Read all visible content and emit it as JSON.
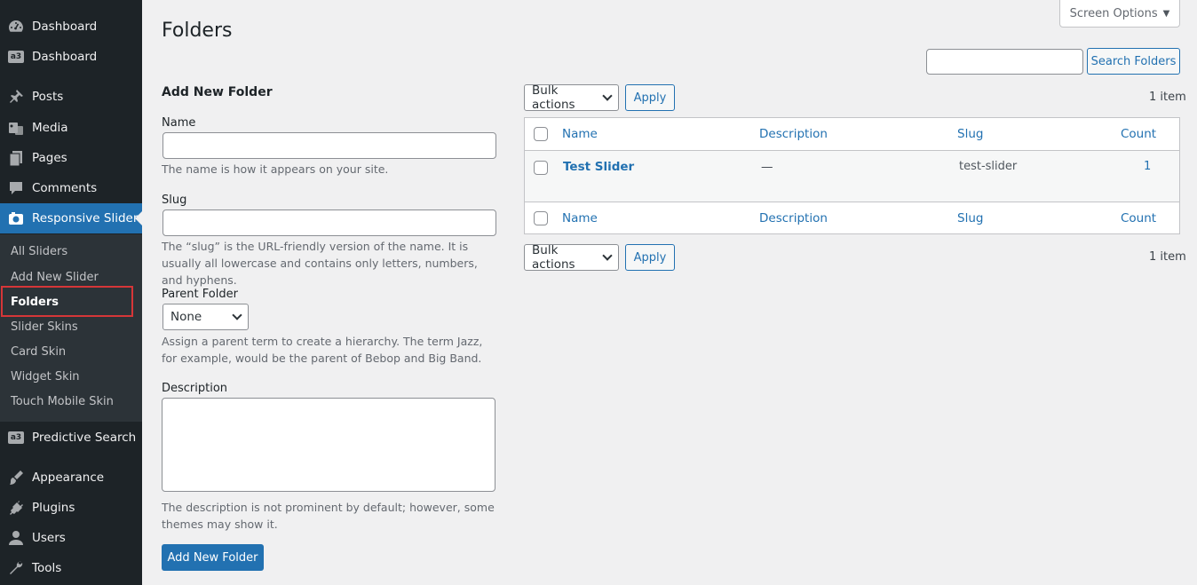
{
  "sidebar": {
    "items": [
      {
        "label": "Dashboard",
        "icon": "dashboard-icon"
      },
      {
        "label": "Dashboard",
        "icon": "a3-icon"
      },
      {
        "label": "Posts",
        "icon": "pin-icon"
      },
      {
        "label": "Media",
        "icon": "media-icon"
      },
      {
        "label": "Pages",
        "icon": "pages-icon"
      },
      {
        "label": "Comments",
        "icon": "comment-icon"
      },
      {
        "label": "Responsive Slider",
        "icon": "camera-icon"
      },
      {
        "label": "Predictive Search",
        "icon": "a3-icon"
      },
      {
        "label": "Appearance",
        "icon": "brush-icon"
      },
      {
        "label": "Plugins",
        "icon": "plug-icon"
      },
      {
        "label": "Users",
        "icon": "user-icon"
      },
      {
        "label": "Tools",
        "icon": "wrench-icon"
      }
    ],
    "submenu": [
      "All Sliders",
      "Add New Slider",
      "Folders",
      "Slider Skins",
      "Card Skin",
      "Widget Skin",
      "Touch Mobile Skin"
    ],
    "a3_badge": "a3"
  },
  "page": {
    "title": "Folders",
    "screen_options": "Screen Options",
    "search_button": "Search Folders"
  },
  "form": {
    "heading": "Add New Folder",
    "name_label": "Name",
    "name_help": "The name is how it appears on your site.",
    "slug_label": "Slug",
    "slug_help": "The “slug” is the URL-friendly version of the name. It is usually all lowercase and contains only letters, numbers, and hyphens.",
    "parent_label": "Parent Folder",
    "parent_value": "None",
    "parent_help": "Assign a parent term to create a hierarchy. The term Jazz, for example, would be the parent of Bebop and Big Band.",
    "description_label": "Description",
    "description_help": "The description is not prominent by default; however, some themes may show it.",
    "submit": "Add New Folder"
  },
  "table": {
    "bulk_actions": "Bulk actions",
    "apply": "Apply",
    "item_count": "1 item",
    "columns": [
      "Name",
      "Description",
      "Slug",
      "Count"
    ],
    "rows": [
      {
        "name": "Test Slider",
        "description": "—",
        "slug": "test-slider",
        "count": "1"
      }
    ]
  },
  "colors": {
    "sidebar_bg": "#1d2327",
    "accent": "#2271b1",
    "highlight_border": "#d63638"
  }
}
